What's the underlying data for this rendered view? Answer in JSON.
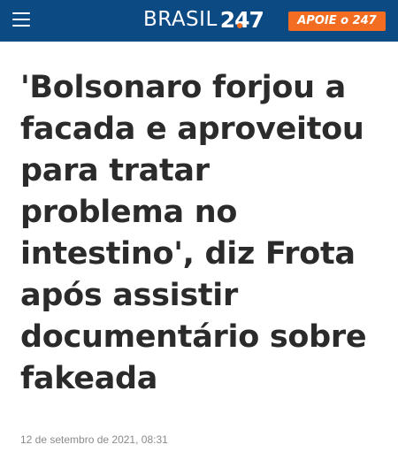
{
  "header": {
    "logo_word": "BRASIL",
    "logo_number": "247",
    "support_button": "APOIE o 247",
    "menu_icon": "hamburger-menu-icon",
    "colors": {
      "bar": "#0c4a84",
      "accent": "#f26d21"
    }
  },
  "article": {
    "headline": "'Bolsonaro forjou a\nfacada e aproveitou\npara tratar\nproblema no\nintestino', diz Frota\napós assistir\ndocumentário sobre\nfakeada",
    "date": "12 de setembro de 2021, 08:31"
  }
}
